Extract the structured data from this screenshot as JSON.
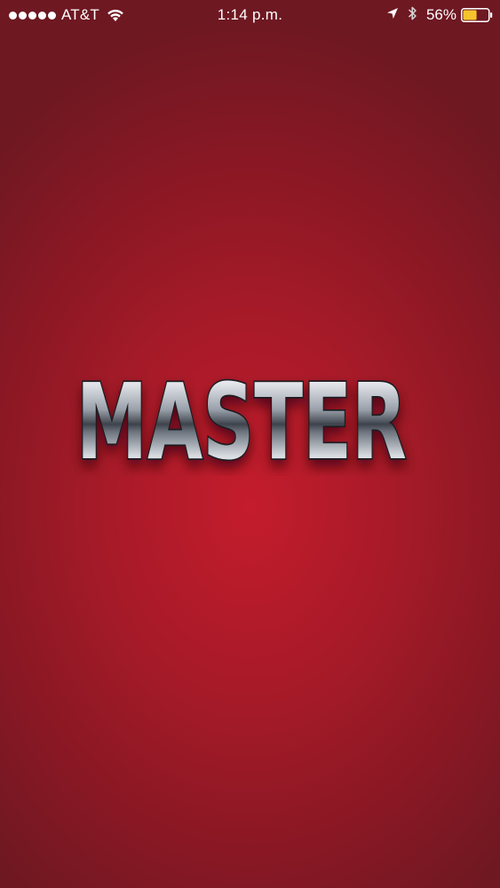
{
  "status_bar": {
    "carrier": "AT&T",
    "signal_bars": 5,
    "time": "1:14 p.m.",
    "battery_percent": "56%",
    "battery_level": 0.56,
    "icons": [
      "signal-dots-icon",
      "wifi-icon",
      "location-arrow-icon",
      "bluetooth-icon",
      "battery-icon"
    ]
  },
  "splash": {
    "logo_text": "MASTER"
  },
  "colors": {
    "background_center": "#c41c2c",
    "background_edge": "#6e1822",
    "battery_fill": "#f5c32c",
    "status_text": "#ffffff"
  }
}
